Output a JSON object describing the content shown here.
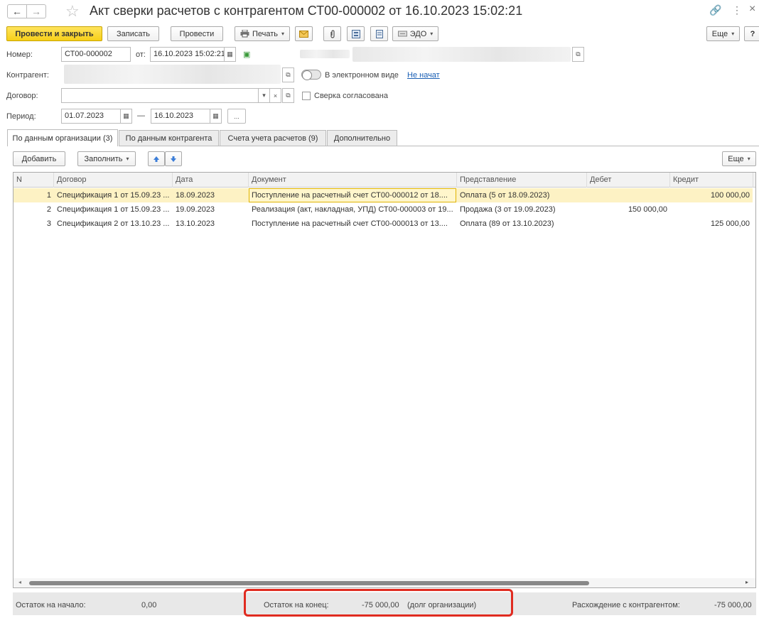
{
  "window": {
    "title": "Акт сверки расчетов с контрагентом СТ00-000002 от 16.10.2023 15:02:21",
    "back_icon": "←",
    "forward_icon": "→",
    "star_icon": "☆",
    "link_icon": "🔗",
    "more_icon": "⋮",
    "close_icon": "×"
  },
  "toolbar": {
    "post_close": "Провести и закрыть",
    "save": "Записать",
    "post": "Провести",
    "print": "Печать",
    "edo": "ЭДО",
    "more": "Еще",
    "help": "?"
  },
  "form": {
    "number_label": "Номер:",
    "number_value": "СТ00-000002",
    "date_label": "от:",
    "date_value": "16.10.2023 15:02:21",
    "counterparty_label": "Контрагент:",
    "electronic_label": "В электронном виде",
    "electronic_status": "Не начат",
    "contract_label": "Договор:",
    "contract_value": "",
    "agreed_label": "Сверка согласована",
    "period_label": "Период:",
    "period_from": "01.07.2023",
    "period_dash": "—",
    "period_to": "16.10.2023",
    "period_btn": "..."
  },
  "tabs": [
    {
      "label": "По данным организации (3)"
    },
    {
      "label": "По данным контрагента"
    },
    {
      "label": "Счета учета расчетов (9)"
    },
    {
      "label": "Дополнительно"
    }
  ],
  "table_toolbar": {
    "add": "Добавить",
    "fill": "Заполнить",
    "more": "Еще"
  },
  "table": {
    "columns": [
      "N",
      "Договор",
      "Дата",
      "Документ",
      "Представление",
      "Дебет",
      "Кредит"
    ],
    "rows": [
      {
        "n": "1",
        "contract": "Спецификация 1 от 15.09.23 ...",
        "date": "18.09.2023",
        "document": "Поступление на расчетный счет СТ00-000012 от 18....",
        "repr": "Оплата (5 от 18.09.2023)",
        "debit": "",
        "credit": "100 000,00"
      },
      {
        "n": "2",
        "contract": "Спецификация 1 от 15.09.23 ...",
        "date": "19.09.2023",
        "document": "Реализация (акт, накладная, УПД) СТ00-000003 от 19...",
        "repr": "Продажа (3 от 19.09.2023)",
        "debit": "150 000,00",
        "credit": ""
      },
      {
        "n": "3",
        "contract": "Спецификация 2 от 13.10.23 ...",
        "date": "13.10.2023",
        "document": "Поступление на расчетный счет СТ00-000013 от 13....",
        "repr": "Оплата (89 от 13.10.2023)",
        "debit": "",
        "credit": "125 000,00"
      }
    ]
  },
  "footer": {
    "start_label": "Остаток на начало:",
    "start_value": "0,00",
    "end_label": "Остаток на конец:",
    "end_value": "-75 000,00",
    "end_note": "(долг организации)",
    "diff_label": "Расхождение с контрагентом:",
    "diff_value": "-75 000,00"
  },
  "colors": {
    "primary_button": "#f6cf19",
    "selected_row": "#fdf2c4",
    "highlight": "#e02b20",
    "link": "#1a5fb4"
  }
}
